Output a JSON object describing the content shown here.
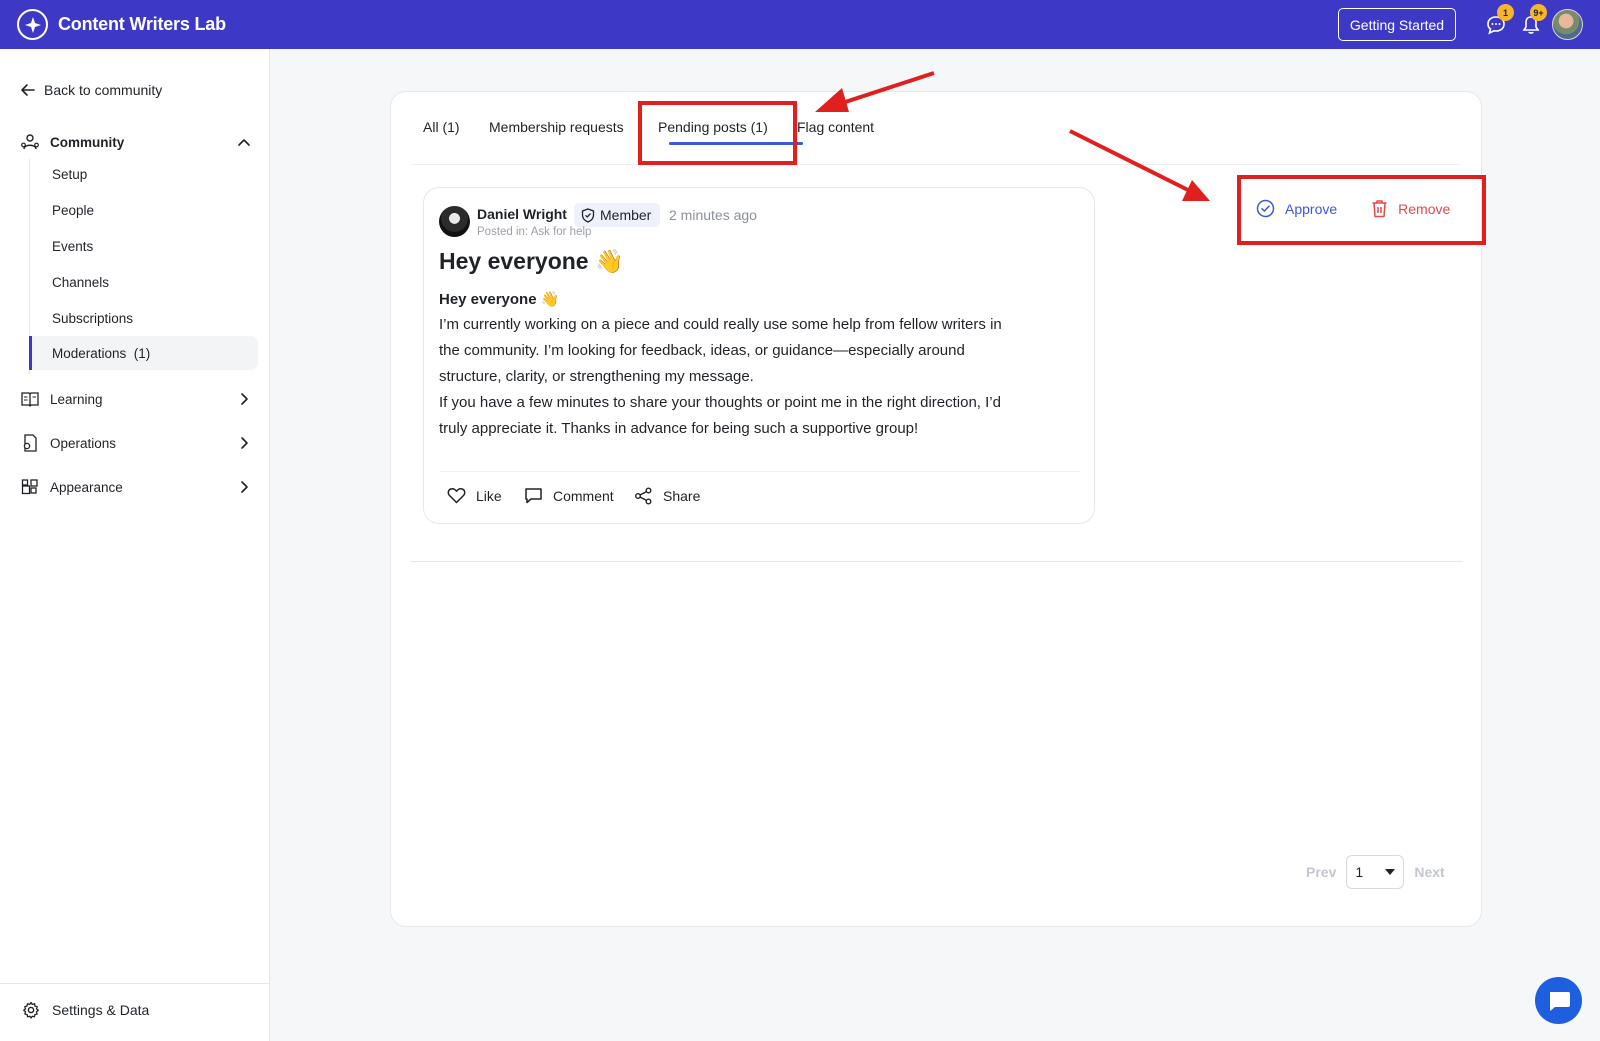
{
  "app": {
    "title": "Content Writers Lab"
  },
  "topbar": {
    "getting_started": "Getting Started",
    "messages_badge": "1",
    "notifications_badge": "9+",
    "accent": "#3d39c6"
  },
  "sidebar": {
    "back_label": "Back to community",
    "sections": {
      "community": "Community",
      "learning": "Learning",
      "operations": "Operations",
      "appearance": "Appearance"
    },
    "community_items": [
      "Setup",
      "People",
      "Events",
      "Channels",
      "Subscriptions",
      "Moderations  (1)"
    ],
    "settings_label": "Settings & Data"
  },
  "tabs": [
    "All (1)",
    "Membership requests",
    "Pending posts (1)",
    "Flag content"
  ],
  "active_tab": "Pending posts (1)",
  "post": {
    "author": "Daniel Wright",
    "role": "Member",
    "time_ago": "2 minutes ago",
    "posted_in": "Posted in: Ask for help",
    "title": "Hey everyone 👋",
    "body_heading": "Hey everyone 👋",
    "body_lines": [
      "I’m currently working on a piece and could really use some help from fellow writers in",
      "the community. I’m looking for feedback, ideas, or guidance—especially around",
      "structure, clarity, or strengthening my message.",
      "If you have a few minutes to share your thoughts or point me in the right direction, I’d",
      "truly appreciate it. Thanks in advance for being such a supportive group!"
    ],
    "actions": {
      "like": "Like",
      "comment": "Comment",
      "share": "Share"
    }
  },
  "moderation": {
    "approve": "Approve",
    "remove": "Remove",
    "approve_color": "#3d56d6",
    "remove_color": "#e54848"
  },
  "pagination": {
    "prev": "Prev",
    "page": "1",
    "next": "Next"
  }
}
